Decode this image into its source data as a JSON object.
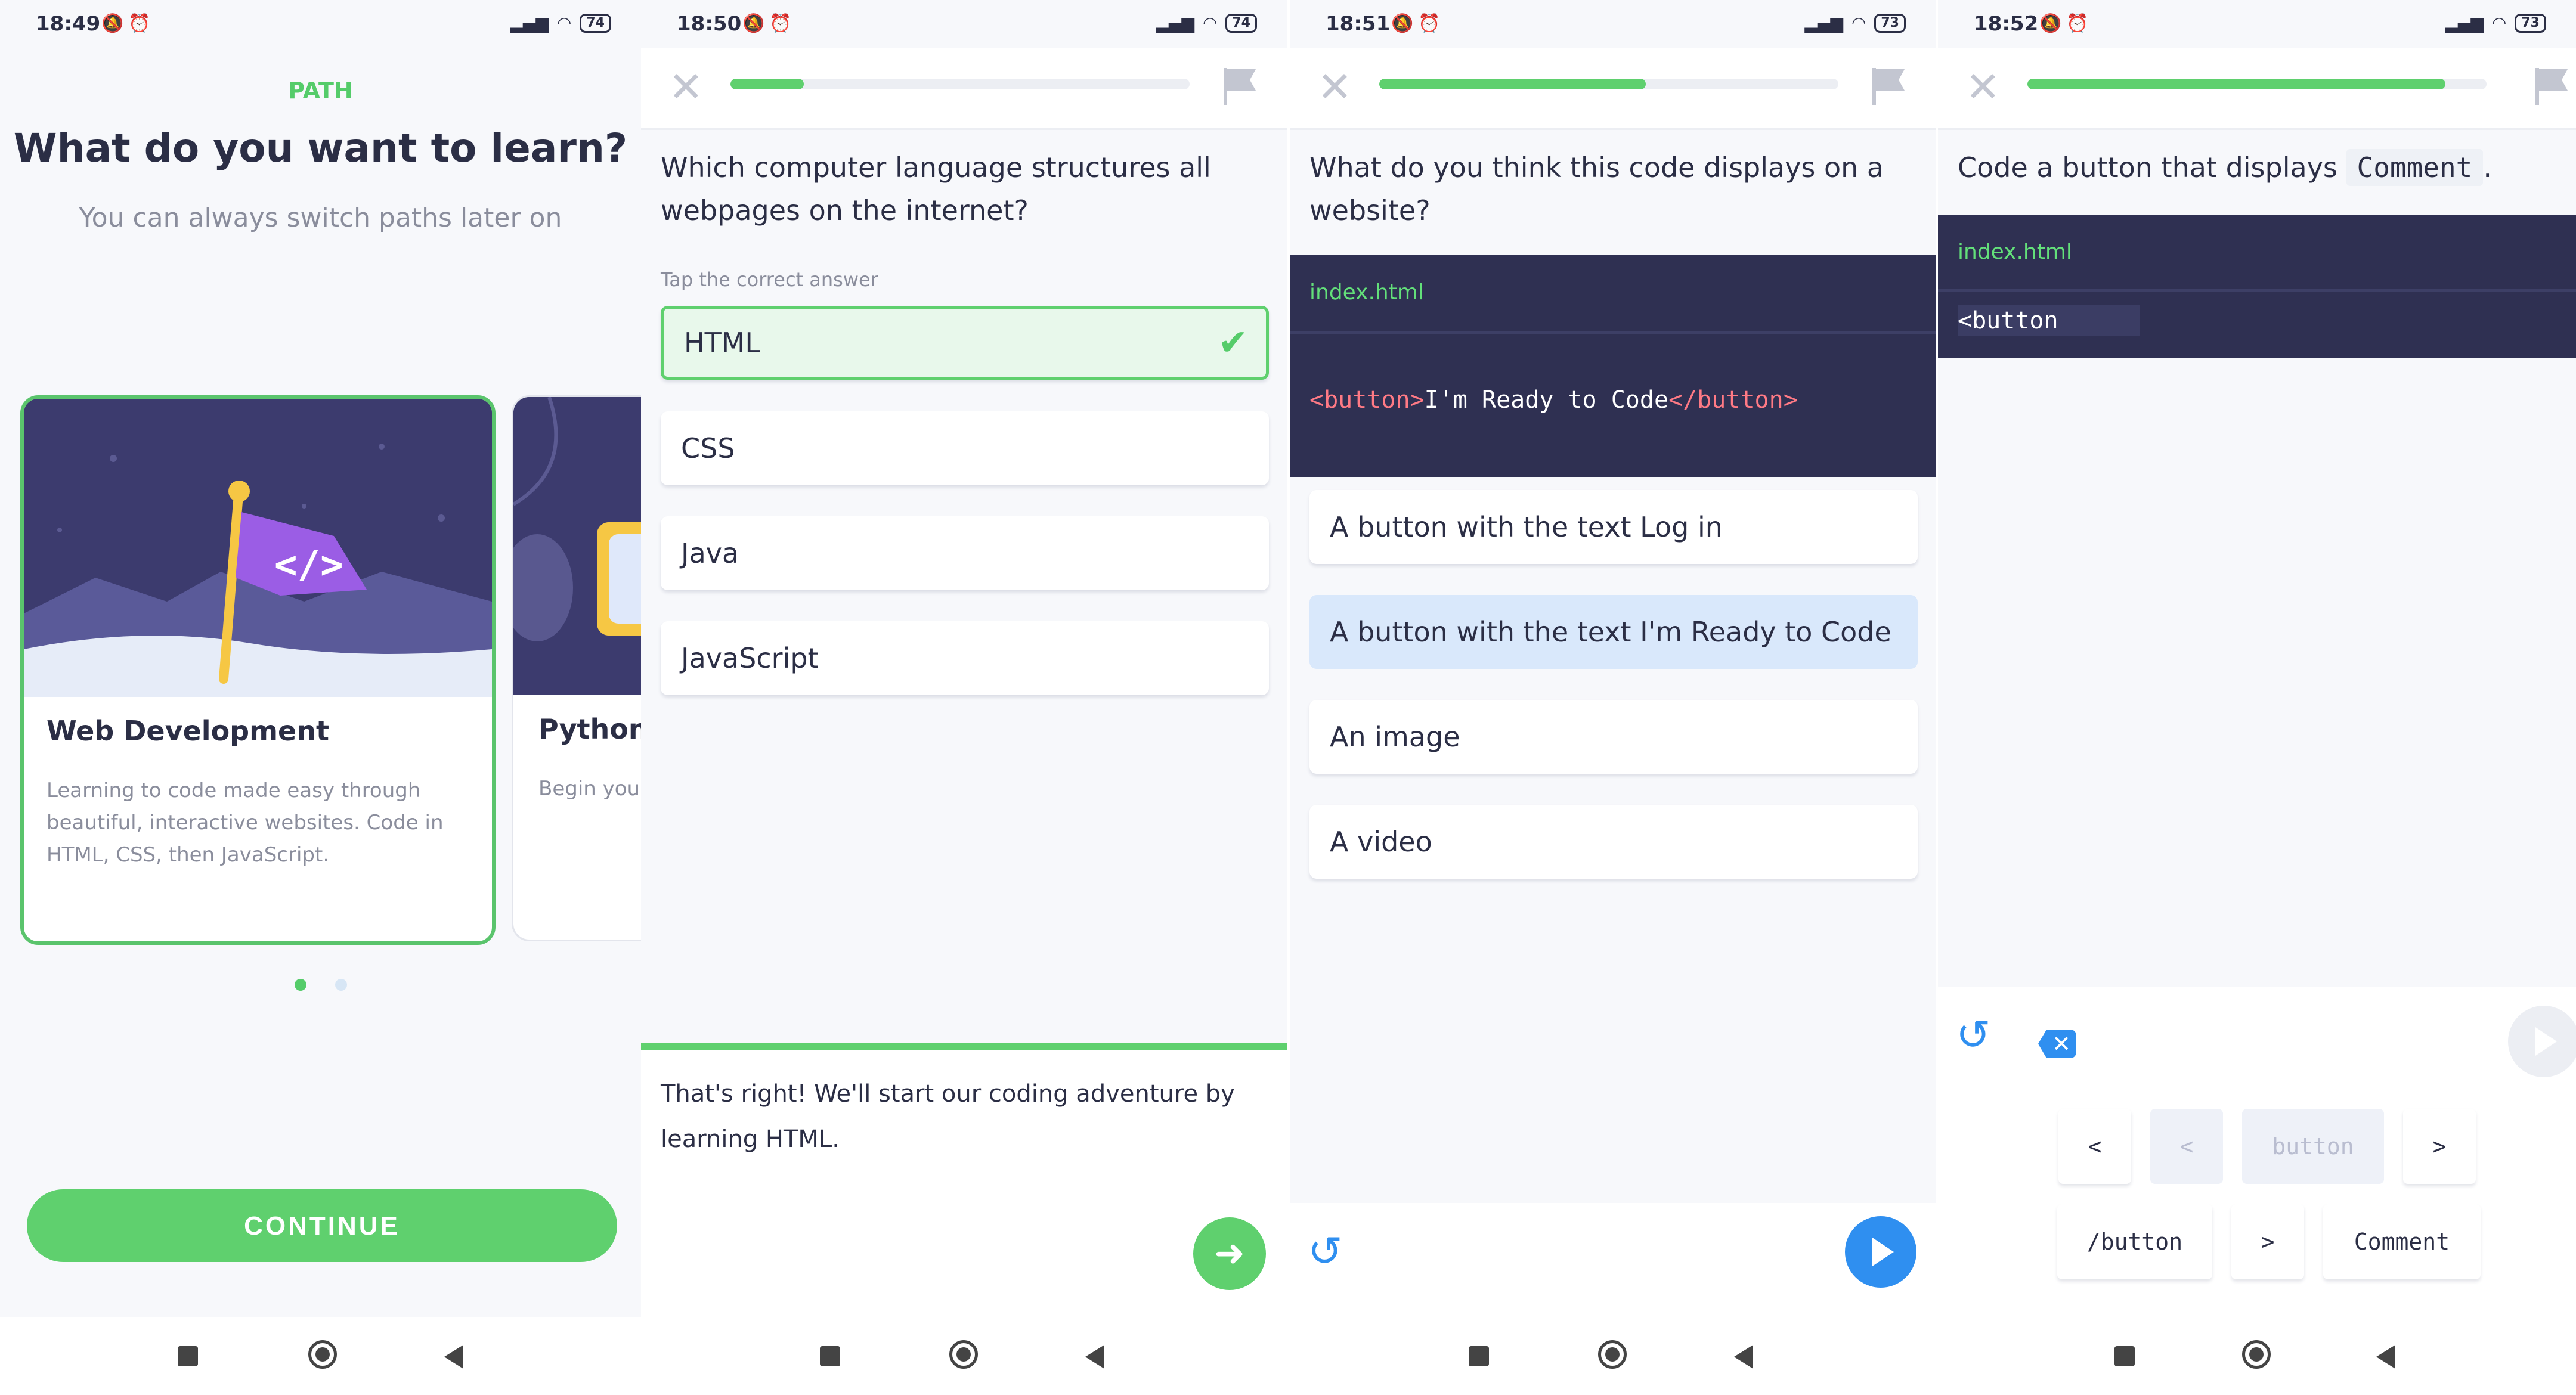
{
  "screens": [
    {
      "status": {
        "time": "18:49",
        "battery": "74"
      }
    },
    {
      "status": {
        "time": "18:50",
        "battery": "74"
      }
    },
    {
      "status": {
        "time": "18:51",
        "battery": "73"
      }
    },
    {
      "status": {
        "time": "18:52",
        "battery": "73"
      }
    }
  ],
  "path_screen": {
    "label": "PATH",
    "title": "What do you want to learn?",
    "subtitle": "You can always switch paths later on",
    "cards": [
      {
        "title": "Web Development",
        "description": "Learning to code made easy through beautiful, interactive websites. Code in HTML, CSS, then JavaScript.",
        "selected": true
      },
      {
        "title": "Python",
        "description": "Begin your all-purpose step in you",
        "selected": false
      }
    ],
    "pager": {
      "pages": 2,
      "current": 1
    },
    "continue_label": "CONTINUE"
  },
  "quiz1": {
    "progress": 0.16,
    "question": "Which computer language structures all webpages on the internet?",
    "hint": "Tap the correct answer",
    "options": [
      "HTML",
      "CSS",
      "Java",
      "JavaScript"
    ],
    "correct_option": "HTML",
    "feedback": "That's right! We'll start our coding adventure by learning HTML."
  },
  "quiz2": {
    "progress": 0.58,
    "question": "What do you think this code displays on a website?",
    "file_name": "index.html",
    "code": {
      "open_tag": "<button>",
      "text": "I'm Ready to Code",
      "close_tag": "</button>"
    },
    "options": [
      "A button with the text Log in",
      "A button with the text I'm Ready to Code",
      "An image",
      "A video"
    ],
    "selected_option": "A button with the text I'm Ready to Code"
  },
  "quiz3": {
    "progress": 0.91,
    "prompt_prefix": "Code a button that displays",
    "prompt_code": "Comment",
    "prompt_suffix": ".",
    "file_name": "index.html",
    "typed_code": "<button",
    "tokens_row1": [
      "<",
      "<",
      "button",
      ">"
    ],
    "tokens_row2": [
      "/button",
      ">",
      "Comment"
    ]
  },
  "icons": {
    "close": "close-icon",
    "flag": "flag-icon",
    "check": "check-icon",
    "arrow": "arrow-right-icon",
    "reset": "reset-icon",
    "play": "play-icon",
    "backspace": "backspace-icon"
  },
  "colors": {
    "accent_green": "#5fd06e",
    "accent_blue": "#2f8ff0",
    "code_bg": "#2f3052",
    "tag_color": "#ff7a85",
    "text_dark": "#2b2e45"
  }
}
